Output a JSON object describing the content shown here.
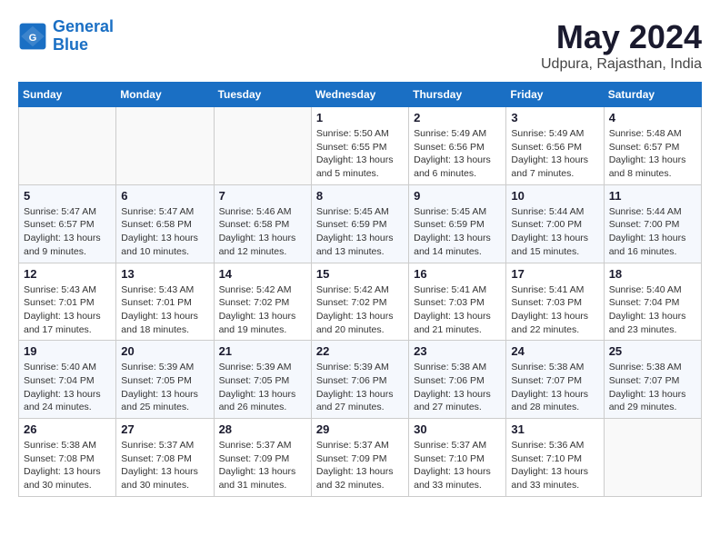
{
  "logo": {
    "line1": "General",
    "line2": "Blue"
  },
  "title": "May 2024",
  "location": "Udpura, Rajasthan, India",
  "days_of_week": [
    "Sunday",
    "Monday",
    "Tuesday",
    "Wednesday",
    "Thursday",
    "Friday",
    "Saturday"
  ],
  "weeks": [
    [
      {
        "day": "",
        "info": ""
      },
      {
        "day": "",
        "info": ""
      },
      {
        "day": "",
        "info": ""
      },
      {
        "day": "1",
        "info": "Sunrise: 5:50 AM\nSunset: 6:55 PM\nDaylight: 13 hours\nand 5 minutes."
      },
      {
        "day": "2",
        "info": "Sunrise: 5:49 AM\nSunset: 6:56 PM\nDaylight: 13 hours\nand 6 minutes."
      },
      {
        "day": "3",
        "info": "Sunrise: 5:49 AM\nSunset: 6:56 PM\nDaylight: 13 hours\nand 7 minutes."
      },
      {
        "day": "4",
        "info": "Sunrise: 5:48 AM\nSunset: 6:57 PM\nDaylight: 13 hours\nand 8 minutes."
      }
    ],
    [
      {
        "day": "5",
        "info": "Sunrise: 5:47 AM\nSunset: 6:57 PM\nDaylight: 13 hours\nand 9 minutes."
      },
      {
        "day": "6",
        "info": "Sunrise: 5:47 AM\nSunset: 6:58 PM\nDaylight: 13 hours\nand 10 minutes."
      },
      {
        "day": "7",
        "info": "Sunrise: 5:46 AM\nSunset: 6:58 PM\nDaylight: 13 hours\nand 12 minutes."
      },
      {
        "day": "8",
        "info": "Sunrise: 5:45 AM\nSunset: 6:59 PM\nDaylight: 13 hours\nand 13 minutes."
      },
      {
        "day": "9",
        "info": "Sunrise: 5:45 AM\nSunset: 6:59 PM\nDaylight: 13 hours\nand 14 minutes."
      },
      {
        "day": "10",
        "info": "Sunrise: 5:44 AM\nSunset: 7:00 PM\nDaylight: 13 hours\nand 15 minutes."
      },
      {
        "day": "11",
        "info": "Sunrise: 5:44 AM\nSunset: 7:00 PM\nDaylight: 13 hours\nand 16 minutes."
      }
    ],
    [
      {
        "day": "12",
        "info": "Sunrise: 5:43 AM\nSunset: 7:01 PM\nDaylight: 13 hours\nand 17 minutes."
      },
      {
        "day": "13",
        "info": "Sunrise: 5:43 AM\nSunset: 7:01 PM\nDaylight: 13 hours\nand 18 minutes."
      },
      {
        "day": "14",
        "info": "Sunrise: 5:42 AM\nSunset: 7:02 PM\nDaylight: 13 hours\nand 19 minutes."
      },
      {
        "day": "15",
        "info": "Sunrise: 5:42 AM\nSunset: 7:02 PM\nDaylight: 13 hours\nand 20 minutes."
      },
      {
        "day": "16",
        "info": "Sunrise: 5:41 AM\nSunset: 7:03 PM\nDaylight: 13 hours\nand 21 minutes."
      },
      {
        "day": "17",
        "info": "Sunrise: 5:41 AM\nSunset: 7:03 PM\nDaylight: 13 hours\nand 22 minutes."
      },
      {
        "day": "18",
        "info": "Sunrise: 5:40 AM\nSunset: 7:04 PM\nDaylight: 13 hours\nand 23 minutes."
      }
    ],
    [
      {
        "day": "19",
        "info": "Sunrise: 5:40 AM\nSunset: 7:04 PM\nDaylight: 13 hours\nand 24 minutes."
      },
      {
        "day": "20",
        "info": "Sunrise: 5:39 AM\nSunset: 7:05 PM\nDaylight: 13 hours\nand 25 minutes."
      },
      {
        "day": "21",
        "info": "Sunrise: 5:39 AM\nSunset: 7:05 PM\nDaylight: 13 hours\nand 26 minutes."
      },
      {
        "day": "22",
        "info": "Sunrise: 5:39 AM\nSunset: 7:06 PM\nDaylight: 13 hours\nand 27 minutes."
      },
      {
        "day": "23",
        "info": "Sunrise: 5:38 AM\nSunset: 7:06 PM\nDaylight: 13 hours\nand 27 minutes."
      },
      {
        "day": "24",
        "info": "Sunrise: 5:38 AM\nSunset: 7:07 PM\nDaylight: 13 hours\nand 28 minutes."
      },
      {
        "day": "25",
        "info": "Sunrise: 5:38 AM\nSunset: 7:07 PM\nDaylight: 13 hours\nand 29 minutes."
      }
    ],
    [
      {
        "day": "26",
        "info": "Sunrise: 5:38 AM\nSunset: 7:08 PM\nDaylight: 13 hours\nand 30 minutes."
      },
      {
        "day": "27",
        "info": "Sunrise: 5:37 AM\nSunset: 7:08 PM\nDaylight: 13 hours\nand 30 minutes."
      },
      {
        "day": "28",
        "info": "Sunrise: 5:37 AM\nSunset: 7:09 PM\nDaylight: 13 hours\nand 31 minutes."
      },
      {
        "day": "29",
        "info": "Sunrise: 5:37 AM\nSunset: 7:09 PM\nDaylight: 13 hours\nand 32 minutes."
      },
      {
        "day": "30",
        "info": "Sunrise: 5:37 AM\nSunset: 7:10 PM\nDaylight: 13 hours\nand 33 minutes."
      },
      {
        "day": "31",
        "info": "Sunrise: 5:36 AM\nSunset: 7:10 PM\nDaylight: 13 hours\nand 33 minutes."
      },
      {
        "day": "",
        "info": ""
      }
    ]
  ]
}
